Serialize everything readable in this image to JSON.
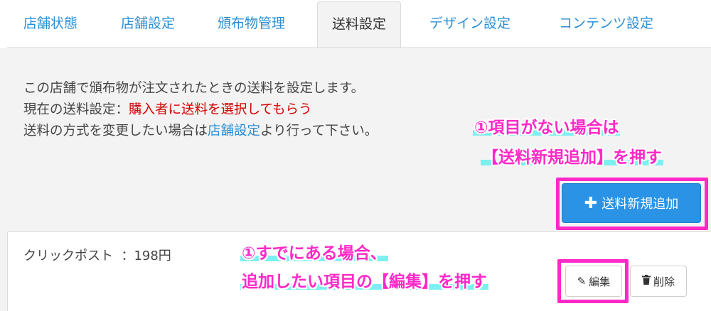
{
  "tabs": [
    {
      "label": "店舗状態"
    },
    {
      "label": "店舗設定"
    },
    {
      "label": "頒布物管理"
    },
    {
      "label": "送料設定"
    },
    {
      "label": "デザイン設定"
    },
    {
      "label": "コンテンツ設定"
    }
  ],
  "description": {
    "line1": "この店舗で頒布物が注文されたときの送料を設定します。",
    "line2_prefix": "現在の送料設定：",
    "line2_value": "購入者に送料を選択してもらう",
    "line3_prefix": "送料の方式を変更したい場合は",
    "line3_link": "店舗設定",
    "line3_suffix": "より行って下さい。"
  },
  "annotations": {
    "top_line1": "①項目がない場合は",
    "top_line2": "【送料新規追加】を押す",
    "bottom_line1": "①すでにある場合、",
    "bottom_line2": "追加したい項目の【編集】を押す",
    "accent_color": "#ff29c7",
    "highlight_color": "#7cf0f0"
  },
  "new_button": {
    "icon": "plus-icon",
    "label": "送料新規追加"
  },
  "shipping_items": [
    {
      "name": "クリックポスト",
      "separator": "：",
      "price": "198円"
    }
  ],
  "item_actions": {
    "edit_icon": "edit-icon",
    "edit_label": "編集",
    "delete_icon": "trash-icon",
    "delete_label": "削除"
  }
}
